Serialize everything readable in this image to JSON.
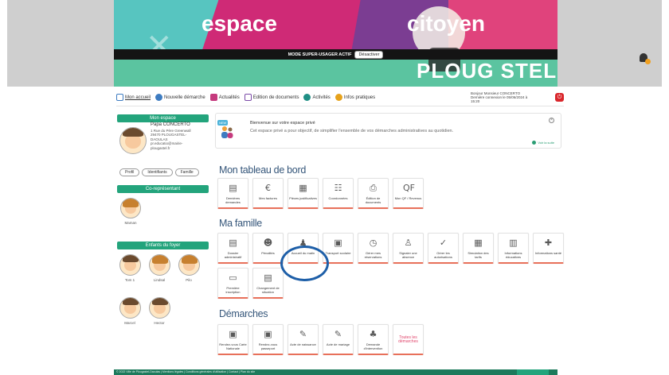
{
  "banner": {
    "title_left": "espace",
    "title_right": "citoyen",
    "super_user_label": "MODE SUPER-USAGER ACTIF",
    "deactivate_label": "Désactiver",
    "logo_text": "PLOUG STEL"
  },
  "nav": {
    "items": [
      {
        "label": "Mon accueil",
        "color": "#3e7cc1"
      },
      {
        "label": "Nouvelle démarche",
        "color": "#3e7cc1"
      },
      {
        "label": "Actualités",
        "color": "#c53a7d"
      },
      {
        "label": "Edition de documents",
        "color": "#7b4aa8"
      },
      {
        "label": "Activités",
        "color": "#1f8f85"
      },
      {
        "label": "Infos pratiques",
        "color": "#e6a21c"
      }
    ],
    "user_greeting": "Bonjour Monsieur CONCERTO",
    "user_last_connection": "Dernière connexion le 05/06/2024 à",
    "user_last_time": "15:20"
  },
  "sidebar": {
    "my_space_title": "Mon espace",
    "profile_name": "Papa CONCERTO",
    "profile_address_1": "1 Rue du Père Greenwall",
    "profile_address_2": "29470 PLOUGASTEL-",
    "profile_address_3": "DAOULAS",
    "profile_email_1": "pr.educatio@mairie-",
    "profile_email_2": "plougastel.fr",
    "pills": [
      "Profil",
      "Identifiants",
      "Famille"
    ],
    "spouse_title": "Co-représentant",
    "spouse_name": "Maman",
    "children_title": "Enfants du foyer",
    "children": [
      "Tom 1",
      "Lindsal",
      "Pilo",
      "Marcel",
      "Hector"
    ]
  },
  "welcome": {
    "badge": "NEW",
    "title": "Bienvenue sur votre espace privé",
    "description": "Cet espace privé a pour objectif, de simplifier l'ensemble de vos démarches administratives au quotidien.",
    "more_link": "Voir la suite"
  },
  "dashboard": {
    "title": "Mon tableau de bord",
    "tiles": [
      {
        "label": "Dernières demandes",
        "icon": "document-list-icon",
        "glyph": "▤"
      },
      {
        "label": "Mes factures",
        "icon": "invoice-euro-icon",
        "glyph": "€"
      },
      {
        "label": "Pièces justificatives",
        "icon": "attachments-icon",
        "glyph": "▦"
      },
      {
        "label": "Coordonnées",
        "icon": "contact-card-icon",
        "glyph": "☷"
      },
      {
        "label": "Édition de documents",
        "icon": "printer-icon",
        "glyph": "⎙"
      },
      {
        "label": "Mon QF / Revenus",
        "icon": "qf-icon",
        "glyph": "QF"
      }
    ]
  },
  "family": {
    "title": "Ma famille",
    "tiles": [
      {
        "label": "Dossier administratif",
        "icon": "admin-folder-icon",
        "glyph": "▤"
      },
      {
        "label": "Pénalités",
        "icon": "penalty-icon",
        "glyph": "☻"
      },
      {
        "label": "Accueil du matin",
        "icon": "morning-welcome-icon",
        "glyph": "♟"
      },
      {
        "label": "Transport scolaire",
        "icon": "bus-icon",
        "glyph": "▣"
      },
      {
        "label": "Gérer mes réservations",
        "icon": "clock-icon",
        "glyph": "◷"
      },
      {
        "label": "Signaler une absence",
        "icon": "person-absence-icon",
        "glyph": "♙"
      },
      {
        "label": "Gérer les autorisations",
        "icon": "checkmark-icon",
        "glyph": "✓"
      },
      {
        "label": "Simulation des tarifs",
        "icon": "calculator-icon",
        "glyph": "▦"
      },
      {
        "label": "Informations éducatives",
        "icon": "info-card-icon",
        "glyph": "▥"
      },
      {
        "label": "Informations santé",
        "icon": "health-icon",
        "glyph": "✚"
      },
      {
        "label": "Première inscription",
        "icon": "briefcase-icon",
        "glyph": "▭"
      },
      {
        "label": "Changement de situation",
        "icon": "change-doc-icon",
        "glyph": "▤"
      }
    ]
  },
  "procedures": {
    "title": "Démarches",
    "tiles": [
      {
        "label": "Rendez-vous Carte Nationale",
        "icon": "id-card-icon",
        "glyph": "▣"
      },
      {
        "label": "Rendez-vous passeport",
        "icon": "passport-icon",
        "glyph": "▣"
      },
      {
        "label": "Acte de naissance",
        "icon": "birth-certificate-icon",
        "glyph": "✎"
      },
      {
        "label": "Acte de mariage",
        "icon": "marriage-certificate-icon",
        "glyph": "✎"
      },
      {
        "label": "Demande d'intervention",
        "icon": "intervention-icon",
        "glyph": "♣"
      }
    ],
    "all_label": "Toutes les démarches"
  },
  "footer": {
    "text": "© 2022 Ville de Plougastel-Daoulas | Mentions légales | Conditions générales d'utilisation | Contact | Plan du site"
  },
  "colors": {
    "accent_green": "#23a47c",
    "section_title": "#35567a",
    "tile_underline": "#e8705a",
    "highlight_ring": "#1e5fa8"
  }
}
